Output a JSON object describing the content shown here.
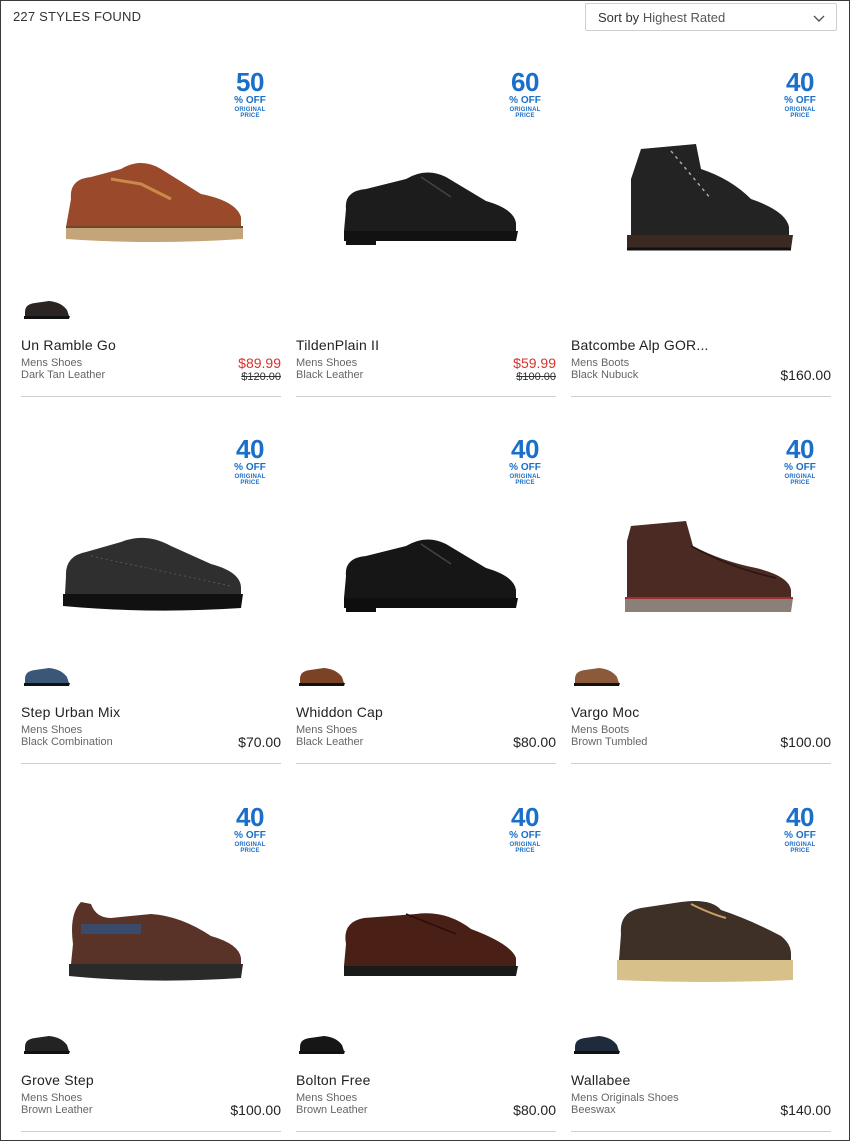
{
  "header": {
    "count_label": "227 STYLES FOUND",
    "sort_label": "Sort by",
    "sort_value": "Highest Rated"
  },
  "badge": {
    "off_label": "% OFF",
    "original_label": "ORIGINAL PRICE"
  },
  "products": [
    {
      "name": "Un Ramble Go",
      "category": "Mens Shoes",
      "color": "Dark Tan Leather",
      "discount": "50",
      "sale_price": "$89.99",
      "original_price": "$120.00",
      "price": "",
      "shoe_style": "casual",
      "upper_color": "#9a4a2a",
      "sole_color": "#c4a57a",
      "swatch_color": "#2a2522"
    },
    {
      "name": "TildenPlain II",
      "category": "Mens Shoes",
      "color": "Black Leather",
      "discount": "60",
      "sale_price": "$59.99",
      "original_price": "$100.00",
      "price": "",
      "shoe_style": "oxford",
      "upper_color": "#1c1c1c",
      "sole_color": "#121212",
      "swatch_color": ""
    },
    {
      "name": "Batcombe Alp GOR...",
      "category": "Mens Boots",
      "color": "Black Nubuck",
      "discount": "40",
      "sale_price": "",
      "original_price": "",
      "price": "$160.00",
      "shoe_style": "boot",
      "upper_color": "#232323",
      "sole_color": "#3a2a22",
      "swatch_color": ""
    },
    {
      "name": "Step Urban Mix",
      "category": "Mens Shoes",
      "color": "Black Combination",
      "discount": "40",
      "sale_price": "",
      "original_price": "",
      "price": "$70.00",
      "shoe_style": "sneaker",
      "upper_color": "#2f2f2f",
      "sole_color": "#111111",
      "swatch_color": "#3b5777"
    },
    {
      "name": "Whiddon Cap",
      "category": "Mens Shoes",
      "color": "Black Leather",
      "discount": "40",
      "sale_price": "",
      "original_price": "",
      "price": "$80.00",
      "shoe_style": "oxford",
      "upper_color": "#161616",
      "sole_color": "#0e0e0e",
      "swatch_color": "#7a4326"
    },
    {
      "name": "Vargo Moc",
      "category": "Mens Boots",
      "color": "Brown Tumbled",
      "discount": "40",
      "sale_price": "",
      "original_price": "",
      "price": "$100.00",
      "shoe_style": "chukka",
      "upper_color": "#4a2a22",
      "sole_color": "#8a8078",
      "swatch_color": "#8a5a3a"
    },
    {
      "name": "Grove Step",
      "category": "Mens Shoes",
      "color": "Brown Leather",
      "discount": "40",
      "sale_price": "",
      "original_price": "",
      "price": "$100.00",
      "shoe_style": "slipon",
      "upper_color": "#5a3328",
      "sole_color": "#2a2a2a",
      "swatch_color": "#232323"
    },
    {
      "name": "Bolton Free",
      "category": "Mens Shoes",
      "color": "Brown Leather",
      "discount": "40",
      "sale_price": "",
      "original_price": "",
      "price": "$80.00",
      "shoe_style": "loafer",
      "upper_color": "#4a1f16",
      "sole_color": "#1a1a1a",
      "swatch_color": "#161616"
    },
    {
      "name": "Wallabee",
      "category": "Mens Originals Shoes",
      "color": "Beeswax",
      "discount": "40",
      "sale_price": "",
      "original_price": "",
      "price": "$140.00",
      "shoe_style": "wallabee",
      "upper_color": "#3e3027",
      "sole_color": "#d8c08a",
      "swatch_color": "#1f2a3a"
    }
  ],
  "colors": {
    "badge_blue": "#1a6fc9",
    "sale_red": "#d8322c"
  },
  "icons": {
    "sort_chevron": "chevron-down-icon"
  }
}
